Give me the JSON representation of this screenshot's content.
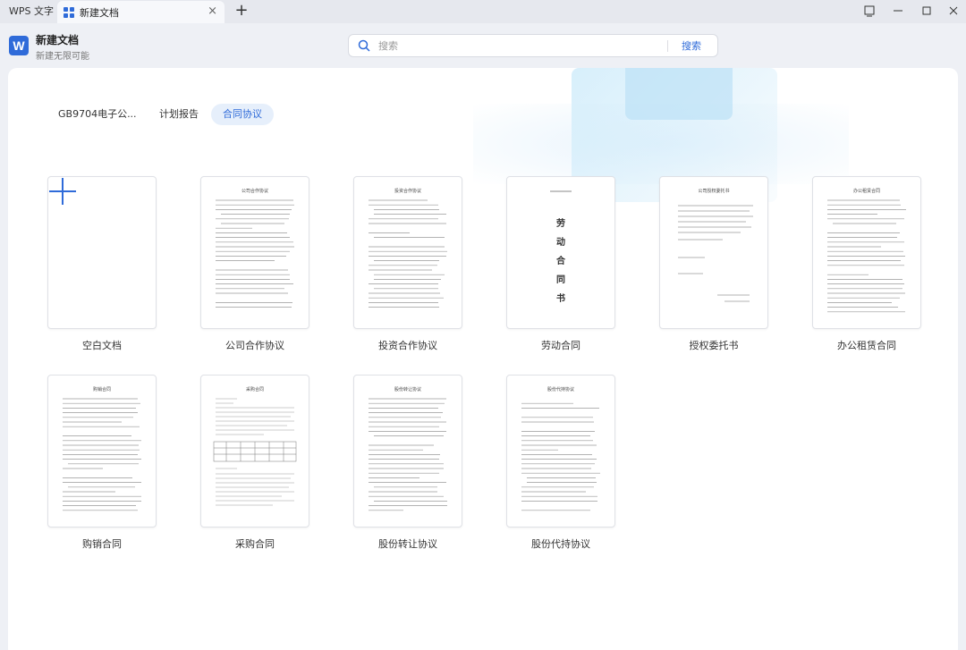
{
  "titlebar": {
    "app_tab_label": "WPS 文字",
    "doc_tab_label": "新建文档",
    "add_tab": "+",
    "close_tab": "×"
  },
  "header": {
    "title": "新建文档",
    "subtitle": "新建无限可能",
    "logo_letter": "W"
  },
  "search": {
    "placeholder": "搜索",
    "button_label": "搜索"
  },
  "categories": [
    {
      "label": "GB9704电子公..."
    },
    {
      "label": "计划报告"
    },
    {
      "label": "合同协议",
      "active": true
    }
  ],
  "templates": [
    {
      "label": "空白文档",
      "thumb": "blank"
    },
    {
      "label": "公司合作协议",
      "thumb": "text",
      "thumb_title": "公司合作协议"
    },
    {
      "label": "投资合作协议",
      "thumb": "text",
      "thumb_title": "投资合作协议"
    },
    {
      "label": "劳动合同",
      "thumb": "labor",
      "thumb_title": "劳动合同书"
    },
    {
      "label": "授权委托书",
      "thumb": "sparse",
      "thumb_title": "公司授权委托书"
    },
    {
      "label": "办公租赁合同",
      "thumb": "text",
      "thumb_title": "办公租赁合同"
    },
    {
      "label": "购销合同",
      "thumb": "text",
      "thumb_title": "购销合同"
    },
    {
      "label": "采购合同",
      "thumb": "table",
      "thumb_title": "采购合同"
    },
    {
      "label": "股份转让协议",
      "thumb": "text",
      "thumb_title": "股份转让协议"
    },
    {
      "label": "股份代持协议",
      "thumb": "text",
      "thumb_title": "股份代持协议"
    }
  ],
  "colors": {
    "accent": "#2f6bd9",
    "active_tab_bg": "#e6effb"
  }
}
